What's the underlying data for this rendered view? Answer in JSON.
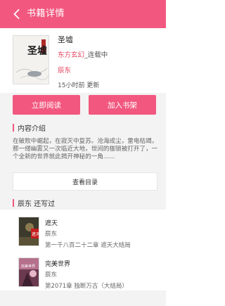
{
  "header": {
    "title": "书籍详情"
  },
  "book": {
    "title": "圣墟",
    "category": "东方玄幻",
    "status": "_连载中",
    "author": "辰东",
    "update_time": "15小时前 更新",
    "cover_text": "圣墟"
  },
  "actions": {
    "read_label": "立即阅读",
    "shelf_label": "加入书架"
  },
  "intro": {
    "title": "内容介绍",
    "text": "在破败中崛起，在寂灭中复苏。沧海成尘，雷电枯竭，那一缕幽雾又一次临近大地，世间的枷锁被打开了，一个全新的世界就此揭开神秘的一角......"
  },
  "catalog": {
    "label": "查看目录"
  },
  "author_section": {
    "title": "辰东  还写过",
    "books": [
      {
        "title": "遮天",
        "author": "辰东",
        "chapter": "第一千八百二十二章 遮天大结局",
        "cover_text": "遮天"
      },
      {
        "title": "完美世界",
        "author": "辰东",
        "chapter": "第2071章 独断万古（大结局）",
        "cover_text": "完美世界"
      }
    ]
  },
  "colors": {
    "accent": "#f2587f",
    "link": "#e5435f"
  }
}
